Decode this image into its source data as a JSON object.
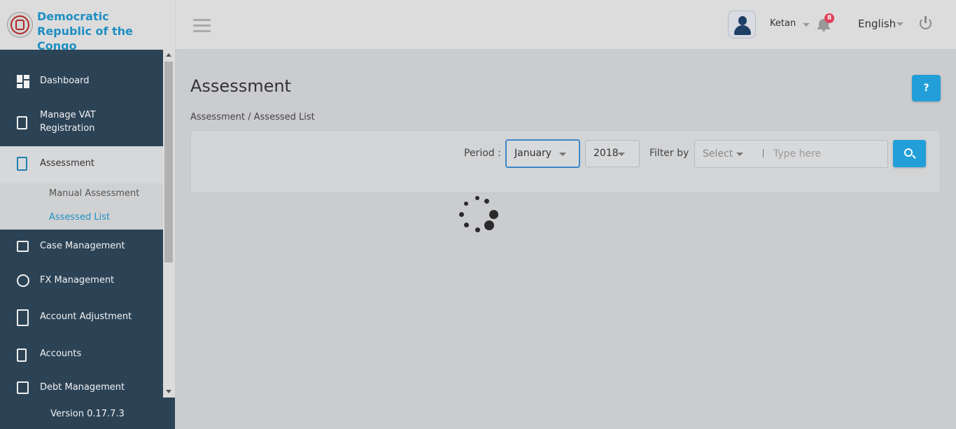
{
  "header": {
    "brand_line1": "Democratic",
    "brand_line2": "Republic of the Congo",
    "username": "Ketan",
    "notification_count": "8",
    "language": "English"
  },
  "sidebar": {
    "items": [
      {
        "label": "Dashboard",
        "icon": "dashboard-icon"
      },
      {
        "label": "Manage VAT Registration",
        "icon": "clipboard-icon"
      },
      {
        "label": "Assessment",
        "icon": "document-search-icon"
      },
      {
        "label": "Case Management",
        "icon": "folder-icon"
      },
      {
        "label": "FX Management",
        "icon": "currency-exchange-icon"
      },
      {
        "label": "Account Adjustment",
        "icon": "calculator-icon"
      },
      {
        "label": "Accounts",
        "icon": "receipt-icon"
      },
      {
        "label": "Debt Management",
        "icon": "debt-icon"
      }
    ],
    "subitems": [
      {
        "label": "Manual Assessment"
      },
      {
        "label": "Assessed List"
      }
    ],
    "version": "Version 0.17.7.3"
  },
  "main": {
    "title": "Assessment",
    "breadcrumb": "Assessment / Assessed List",
    "help_label": "?",
    "period_label": "Period :",
    "month": "January",
    "year": "2018",
    "filter_label": "Filter by",
    "filter_select": "Select",
    "search_placeholder": "Type here"
  },
  "colors": {
    "accent": "#229fd8",
    "sidebar_bg": "#2c4356",
    "badge": "#e0405a"
  }
}
